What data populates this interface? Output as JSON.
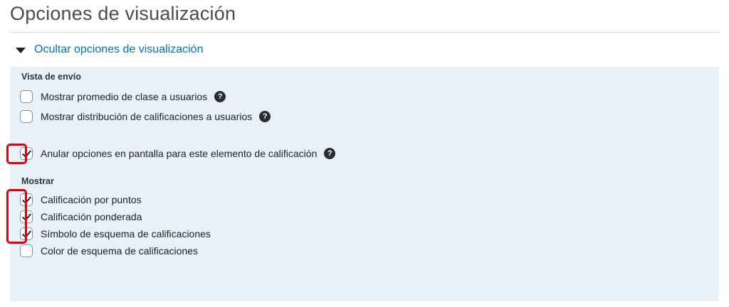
{
  "page": {
    "title": "Opciones de visualización"
  },
  "toggle": {
    "label": "Ocultar opciones de visualización",
    "icon": "triangle-down-icon"
  },
  "submission_view": {
    "label": "Vista de envío",
    "options": [
      {
        "label": "Mostrar promedio de clase a usuarios",
        "checked": false,
        "help": true
      },
      {
        "label": "Mostrar distribución de calificaciones a usuarios",
        "checked": false,
        "help": true
      }
    ],
    "override": {
      "label": "Anular opciones en pantalla para este elemento de calificación",
      "checked": true,
      "help": true
    }
  },
  "display": {
    "label": "Mostrar",
    "options": [
      {
        "label": "Calificación por puntos",
        "checked": true
      },
      {
        "label": "Calificación ponderada",
        "checked": true
      },
      {
        "label": "Símbolo de esquema de calificaciones",
        "checked": true
      },
      {
        "label": "Color de esquema de calificaciones",
        "checked": false
      }
    ]
  },
  "help_icon_glyph": "?",
  "colors": {
    "link": "#006fbf",
    "panel": "#e8f1f7",
    "highlight": "#e3000e"
  }
}
